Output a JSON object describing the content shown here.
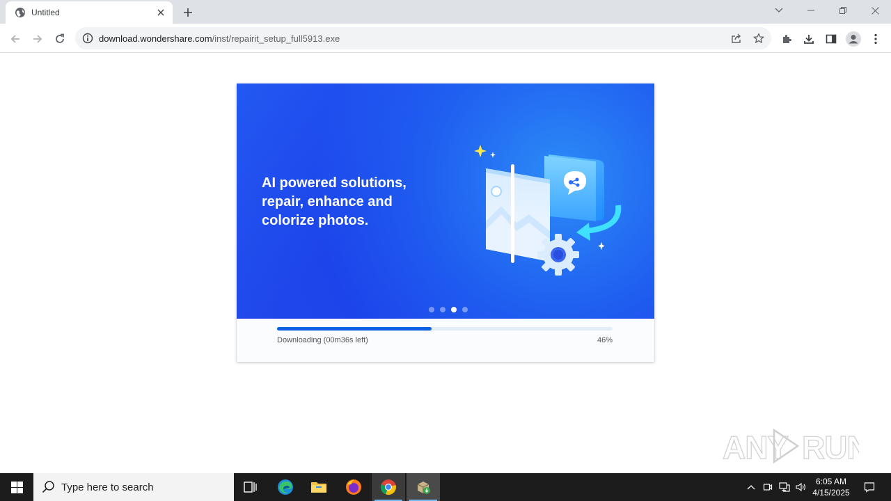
{
  "browser": {
    "tab_title": "Untitled",
    "url_host": "download.wondershare.com",
    "url_path": "/inst/repairit_setup_full5913.exe"
  },
  "installer": {
    "headline": "AI powered solutions, repair, enhance and colorize photos.",
    "carousel_dots": 4,
    "carousel_active_index": 2,
    "progress_fraction": 0.46,
    "status_text": "Downloading (00m36s left)",
    "percent_text": "46%"
  },
  "watermark": {
    "text": "ANY RUN"
  },
  "taskbar": {
    "search_placeholder": "Type here to search",
    "time": "6:05 AM",
    "date": "4/15/2025"
  },
  "colors": {
    "banner_blue": "#1f4ff0",
    "progress_blue": "#0b5fe3",
    "taskbar": "#1c1c1c",
    "tabstrip": "#dee1e6"
  }
}
